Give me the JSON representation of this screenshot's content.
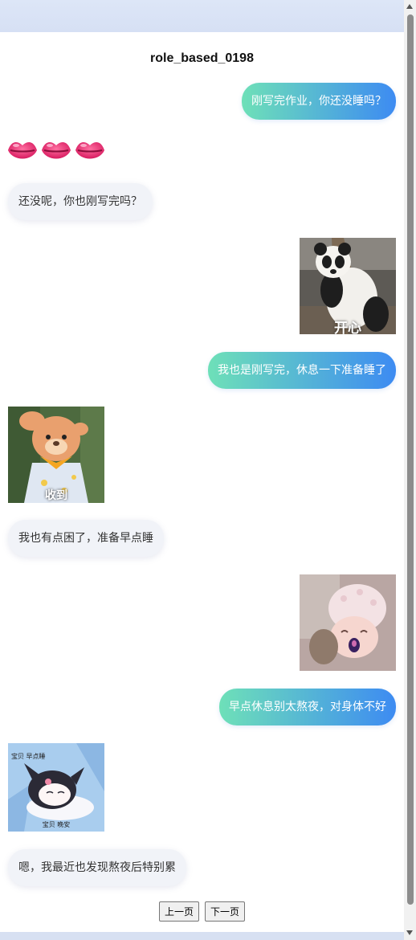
{
  "page": {
    "title": "role_based_0198"
  },
  "messages": [
    {
      "side": "right",
      "type": "text",
      "text": "刚写完作业，你还没睡吗？"
    },
    {
      "side": "left",
      "type": "emoji",
      "text": "💋💋💋"
    },
    {
      "side": "left",
      "type": "text",
      "text": "还没呢，你也刚写完吗？"
    },
    {
      "side": "right",
      "type": "sticker",
      "sticker": "panda-sticker",
      "caption": "开心"
    },
    {
      "side": "right",
      "type": "text",
      "text": "我也是刚写完，休息一下准备睡了"
    },
    {
      "side": "left",
      "type": "sticker",
      "sticker": "bear-salute-sticker",
      "caption": "收到"
    },
    {
      "side": "left",
      "type": "text",
      "text": "我也有点困了，准备早点睡"
    },
    {
      "side": "right",
      "type": "sticker",
      "sticker": "baby-pacifier-sticker",
      "caption": ""
    },
    {
      "side": "right",
      "type": "text",
      "text": "早点休息别太熬夜，对身体不好"
    },
    {
      "side": "left",
      "type": "sticker",
      "sticker": "kuromi-sleeping-sticker",
      "caption_top": "宝贝 早点睡",
      "caption_bottom": "宝贝 晚安"
    },
    {
      "side": "left",
      "type": "text",
      "text": "嗯，我最近也发现熬夜后特别累"
    }
  ],
  "pager": {
    "prev_label": "上一页",
    "next_label": "下一页"
  },
  "colors": {
    "bubble_right_start": "#6ee0b8",
    "bubble_right_end": "#3d8bf2",
    "bubble_left_bg": "#f1f3f8"
  }
}
